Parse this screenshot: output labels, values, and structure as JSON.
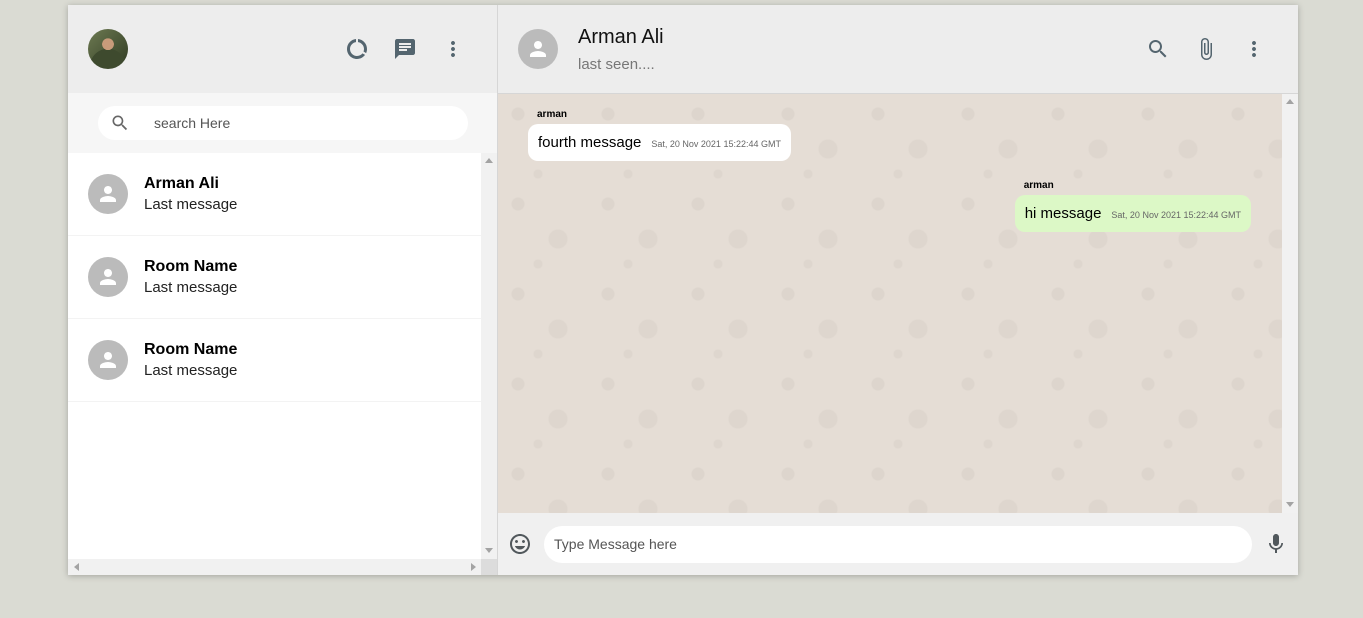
{
  "sidebar": {
    "search": {
      "placeholder": "search Here"
    },
    "chats": [
      {
        "name": "Arman Ali",
        "last_message": "Last message"
      },
      {
        "name": "Room Name",
        "last_message": "Last message"
      },
      {
        "name": "Room Name",
        "last_message": "Last message"
      }
    ]
  },
  "chat": {
    "header": {
      "name": "Arman Ali",
      "status": "last seen...."
    },
    "messages": [
      {
        "sender": "arman",
        "text": "fourth message",
        "timestamp": "Sat, 20 Nov 2021 15:22:44 GMT",
        "direction": "incoming"
      },
      {
        "sender": "arman",
        "text": "hi message",
        "timestamp": "Sat, 20 Nov 2021 15:22:44 GMT",
        "direction": "outgoing"
      }
    ],
    "footer": {
      "input_placeholder": "Type Message here"
    }
  },
  "icons": {
    "sidebar_header": [
      "status-icon",
      "chat-icon",
      "more-vert-icon"
    ],
    "chat_header": [
      "search-icon",
      "attach-icon",
      "more-vert-icon"
    ],
    "footer": [
      "emoji-icon",
      "mic-icon"
    ]
  },
  "colors": {
    "background": "#dadbd3",
    "panel": "#ededed",
    "chat_wallpaper": "#e5ddd5",
    "outgoing_bubble": "#dcf8c6",
    "incoming_bubble": "#ffffff"
  }
}
